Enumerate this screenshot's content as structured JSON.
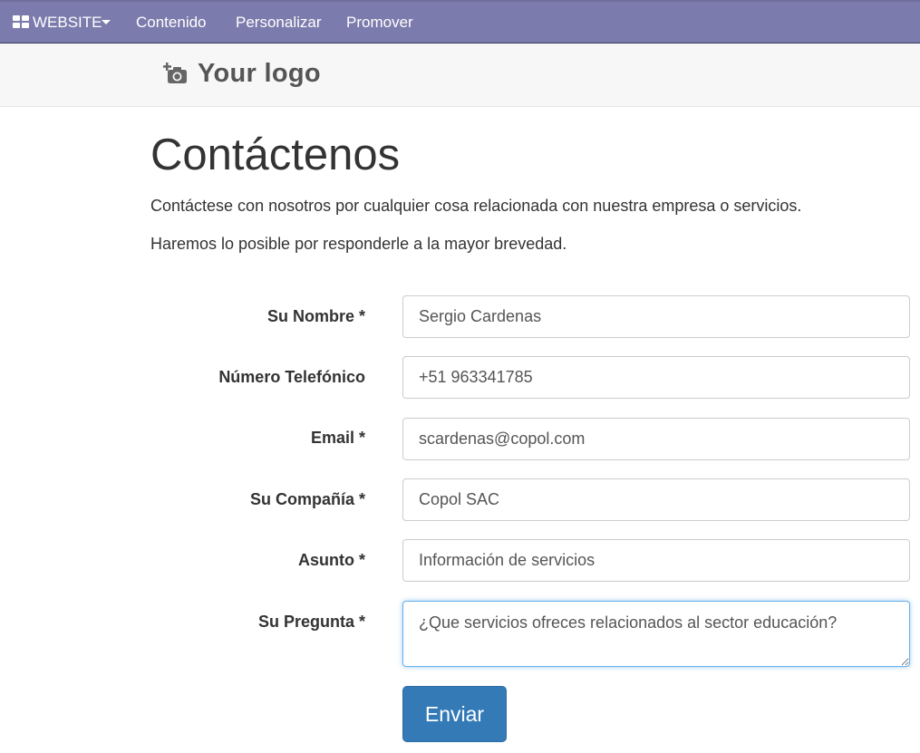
{
  "navbar": {
    "app_menu_label": "WEBSITE",
    "items": [
      "Contenido",
      "Personalizar",
      "Promover"
    ],
    "background": "#7c7bad"
  },
  "header": {
    "logo_text": "Your logo"
  },
  "page": {
    "title": "Contáctenos",
    "intro_line_1": "Contáctese con nosotros por cualquier cosa relacionada con nuestra empresa o servicios.",
    "intro_line_2": "Haremos lo posible por responderle a la mayor brevedad."
  },
  "form": {
    "fields": [
      {
        "label": "Su Nombre *",
        "value": "Sergio Cardenas"
      },
      {
        "label": "Número Telefónico",
        "value": "+51 963341785"
      },
      {
        "label": "Email *",
        "value": "scardenas@copol.com"
      },
      {
        "label": "Su Compañía *",
        "value": "Copol SAC"
      },
      {
        "label": "Asunto *",
        "value": "Información de servicios"
      }
    ],
    "question": {
      "label": "Su Pregunta *",
      "value": "¿Que servicios ofreces relacionados al sector educación?"
    },
    "submit_label": "Enviar",
    "submit_color": "#337ab7"
  }
}
